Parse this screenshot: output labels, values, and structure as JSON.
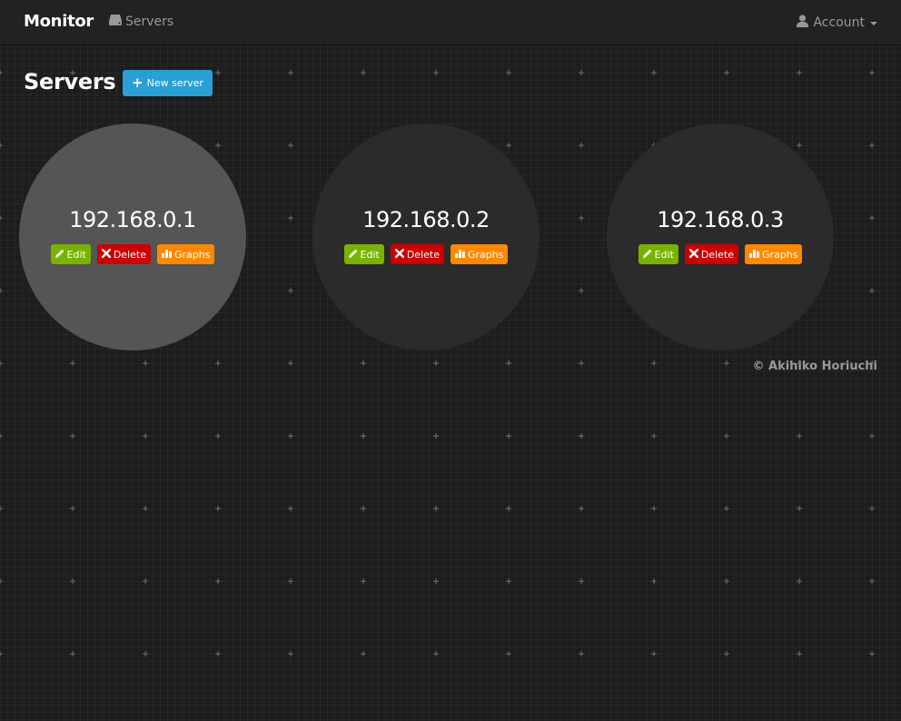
{
  "navbar": {
    "brand": "Monitor",
    "servers_label": "Servers",
    "account_label": "Account",
    "icons": {
      "servers": "hdd-icon",
      "account": "user-icon",
      "account_caret": "caret-down-icon"
    }
  },
  "page": {
    "title": "Servers",
    "new_button_label": "New server",
    "new_button_icon": "plus-icon"
  },
  "servers": [
    {
      "ip": "192.168.0.1",
      "highlighted": true
    },
    {
      "ip": "192.168.0.2",
      "highlighted": false
    },
    {
      "ip": "192.168.0.3",
      "highlighted": false
    }
  ],
  "actions": {
    "edit_label": "Edit",
    "delete_label": "Delete",
    "graphs_label": "Graphs",
    "icons": {
      "edit": "pencil-icon",
      "delete": "x-icon",
      "graphs": "bar-chart-icon"
    }
  },
  "footer": {
    "copyright": "© Akihiko Horiuchi"
  },
  "colors": {
    "primary": "#2a9fd6",
    "success": "#77b300",
    "danger": "#cc0000",
    "warning": "#ff8800",
    "navbar_bg": "#222222",
    "page_bg": "#1d1d1d",
    "circle_active": "#555555",
    "circle_default": "#2b2b2b"
  }
}
